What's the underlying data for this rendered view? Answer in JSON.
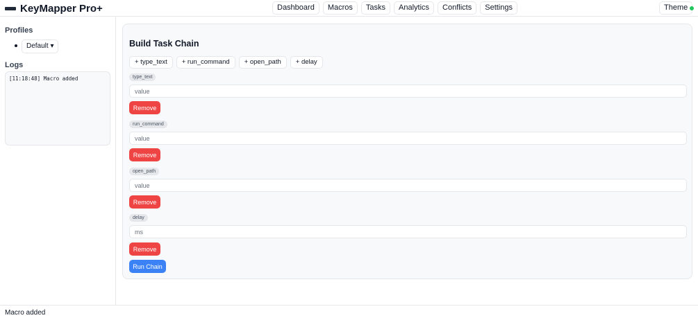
{
  "app": {
    "title": "KeyMapper Pro+"
  },
  "nav": {
    "items": [
      "Dashboard",
      "Macros",
      "Tasks",
      "Analytics",
      "Conflicts",
      "Settings"
    ]
  },
  "header": {
    "theme_label": "Theme",
    "status_color": "#22c55e"
  },
  "sidebar": {
    "profiles_heading": "Profiles",
    "profile_selected": "Default ▾",
    "logs_heading": "Logs",
    "log_lines": [
      "[11:18:48] Macro added"
    ]
  },
  "builder": {
    "title": "Build Task Chain",
    "add_buttons": [
      "+ type_text",
      "+ run_command",
      "+ open_path",
      "+ delay"
    ],
    "steps": [
      {
        "type": "type_text",
        "placeholder": "value",
        "value": "",
        "remove_label": "Remove"
      },
      {
        "type": "run_command",
        "placeholder": "value",
        "value": "",
        "remove_label": "Remove"
      },
      {
        "type": "open_path",
        "placeholder": "value",
        "value": "",
        "remove_label": "Remove"
      },
      {
        "type": "delay",
        "placeholder": "ms",
        "value": "",
        "remove_label": "Remove"
      }
    ],
    "run_label": "Run Chain"
  },
  "footer": {
    "status_text": "Macro added"
  },
  "colors": {
    "danger": "#ef4444",
    "primary": "#3b82f6",
    "status_ok": "#22c55e"
  }
}
